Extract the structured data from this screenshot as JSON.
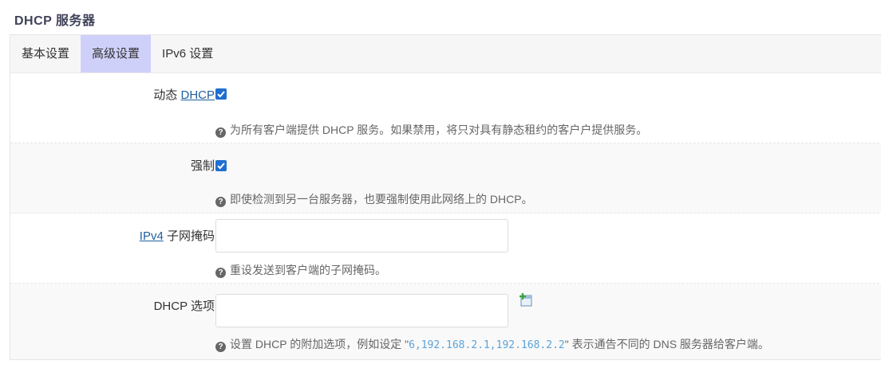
{
  "section_title": "DHCP 服务器",
  "tabs": [
    {
      "label": "基本设置"
    },
    {
      "label": "高级设置"
    },
    {
      "label": "IPv6 设置"
    }
  ],
  "fields": {
    "dynamic_dhcp": {
      "label_prefix": "动态",
      "label_link": "DHCP",
      "checked": true,
      "description": "为所有客户端提供 DHCP 服务。如果禁用，将只对具有静态租约的客户户提供服务。"
    },
    "force": {
      "label": "强制",
      "checked": true,
      "description": "即使检测到另一台服务器，也要强制使用此网络上的 DHCP。"
    },
    "ipv4_netmask": {
      "label_link": "IPv4",
      "label_suffix": "子网掩码",
      "value": "",
      "description": "重设发送到客户端的子网掩码。"
    },
    "dhcp_options": {
      "label": "DHCP 选项",
      "value": "",
      "description_pre": "设置 DHCP 的附加选项，例如设定 \"",
      "description_code": "6,192.168.2.1,192.168.2.2",
      "description_post": "\" 表示通告不同的 DNS 服务器给客户端。"
    }
  },
  "colors": {
    "active_tab": "#cfd0f9",
    "checkbox": "#1f6fd0",
    "link": "#1f5f9e",
    "code": "#5ba3d8"
  }
}
